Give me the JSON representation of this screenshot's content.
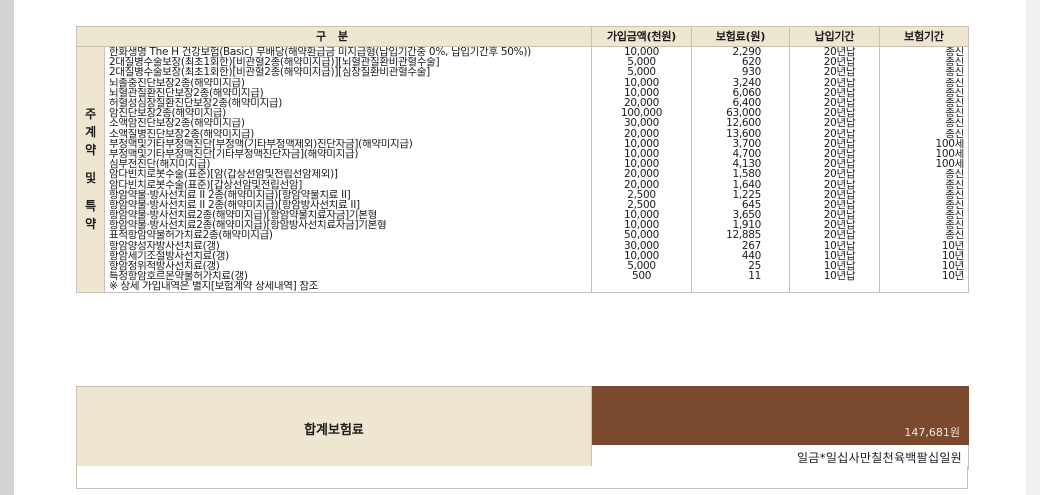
{
  "table": {
    "headers": {
      "division": "구 분",
      "amount": "가입금액(천원)",
      "premium": "보험료(원)",
      "pay_period": "납입기간",
      "ins_period": "보험기간"
    },
    "group_label": [
      "주",
      "계",
      "약",
      "",
      "및",
      "",
      "특",
      "약"
    ],
    "rows": [
      {
        "name": "한화생명 The H 건강보험(Basic) 무배당(해약환급금 미지급형(납입기간중 0%, 납입기간후 50%))",
        "amount": "10,000",
        "premium": "2,290",
        "pay": "20년납",
        "term": "종신"
      },
      {
        "name": "2대질병수술보장(최초1회한)[비관혈2종(해약미지급)][뇌혈관질환비관혈수술]",
        "amount": "5,000",
        "premium": "620",
        "pay": "20년납",
        "term": "종신"
      },
      {
        "name": "2대질병수술보장(최초1회한)[비관혈2종(해약미지급)][심장질환비관혈수술]",
        "amount": "5,000",
        "premium": "930",
        "pay": "20년납",
        "term": "종신"
      },
      {
        "name": "뇌졸중진단보장2종(해약미지급)",
        "amount": "10,000",
        "premium": "3,240",
        "pay": "20년납",
        "term": "종신"
      },
      {
        "name": "뇌혈관질환진단보장2종(해약미지급)",
        "amount": "10,000",
        "premium": "6,060",
        "pay": "20년납",
        "term": "종신"
      },
      {
        "name": "허혈성심장질환진단보장2종(해약미지급)",
        "amount": "20,000",
        "premium": "6,400",
        "pay": "20년납",
        "term": "종신"
      },
      {
        "name": "암진단보장2종(해약미지급)",
        "amount": "100,000",
        "premium": "63,000",
        "pay": "20년납",
        "term": "종신"
      },
      {
        "name": "소액암진단보장2종(해약미지급)",
        "amount": "30,000",
        "premium": "12,600",
        "pay": "20년납",
        "term": "종신"
      },
      {
        "name": "소액질병진단보장2종(해약미지급)",
        "amount": "20,000",
        "premium": "13,600",
        "pay": "20년납",
        "term": "종신"
      },
      {
        "name": "부정맥및기타부정맥진단[부정맥(기타부정맥제외)진단자금](해약미지급)",
        "amount": "10,000",
        "premium": "3,700",
        "pay": "20년납",
        "term": "100세"
      },
      {
        "name": "부정맥및기타부정맥진단[기타부정맥진단자금](해약미지급)",
        "amount": "10,000",
        "premium": "4,700",
        "pay": "20년납",
        "term": "100세"
      },
      {
        "name": "심부전진단(해지미지급)",
        "amount": "10,000",
        "premium": "4,130",
        "pay": "20년납",
        "term": "100세"
      },
      {
        "name": "암다빈치로봇수술(표준)[암(갑상선암및전립선암제외)]",
        "amount": "20,000",
        "premium": "1,580",
        "pay": "20년납",
        "term": "종신"
      },
      {
        "name": "암다빈치로봇수술(표준)[갑상선암및전립선암]",
        "amount": "20,000",
        "premium": "1,640",
        "pay": "20년납",
        "term": "종신"
      },
      {
        "name": "항암약물·방사선치료 II 2종(해약미지급)[항암약물치료 II]",
        "amount": "2,500",
        "premium": "1,225",
        "pay": "20년납",
        "term": "종신"
      },
      {
        "name": "항암약물·방사선치료 II 2종(해약미지급)[항암방사선치료 II]",
        "amount": "2,500",
        "premium": "645",
        "pay": "20년납",
        "term": "종신"
      },
      {
        "name": "항암약물·방사선치료2종(해약미지급)[항암약물치료자금]기본형",
        "amount": "10,000",
        "premium": "3,650",
        "pay": "20년납",
        "term": "종신"
      },
      {
        "name": "항암약물·방사선치료2종(해약미지급)[항암방사선치료자금]기본형",
        "amount": "10,000",
        "premium": "1,910",
        "pay": "20년납",
        "term": "종신"
      },
      {
        "name": "표적항암약물허가치료2종(해약미지급)",
        "amount": "50,000",
        "premium": "12,885",
        "pay": "20년납",
        "term": "종신"
      },
      {
        "name": "항암양성자방사선치료(갱)",
        "amount": "30,000",
        "premium": "267",
        "pay": "10년납",
        "term": "10년"
      },
      {
        "name": "항암세기조절방사선치료(갱)",
        "amount": "10,000",
        "premium": "440",
        "pay": "10년납",
        "term": "10년"
      },
      {
        "name": "항암정위적방사선치료(갱)",
        "amount": "5,000",
        "premium": "25",
        "pay": "10년납",
        "term": "10년"
      },
      {
        "name": "특정항암호르몬약물허가치료(갱)",
        "amount": "500",
        "premium": "11",
        "pay": "10년납",
        "term": "10년"
      }
    ],
    "footnote": "※ 상세 가입내역은 별지[보험계약 상세내역] 참조"
  },
  "total": {
    "label": "합계보험료",
    "amount": "147,681원",
    "amount_korean": "일금*일십사만칠천육백팔십일원"
  },
  "colors": {
    "header_bg": "#efe6d2",
    "total_bg": "#7b4a2e",
    "border": "#c9c2b2"
  }
}
